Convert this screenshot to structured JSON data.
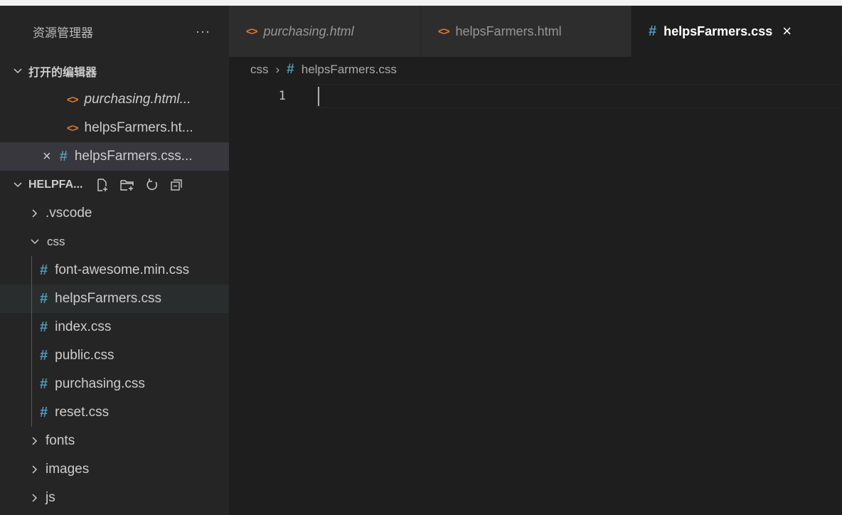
{
  "explorer": {
    "title": "资源管理器",
    "more": "···",
    "open_editors": {
      "label": "打开的编辑器",
      "items": [
        {
          "name": "purchasing.html...",
          "type": "html"
        },
        {
          "name": "helpsFarmers.ht...",
          "type": "html"
        },
        {
          "name": "helpsFarmers.css...",
          "type": "css",
          "close": "×"
        }
      ]
    },
    "workspace": {
      "label": "HELPFA...",
      "tree": [
        {
          "name": ".vscode",
          "kind": "folder",
          "expanded": false
        },
        {
          "name": "css",
          "kind": "folder",
          "expanded": true
        },
        {
          "name": "font-awesome.min.css",
          "kind": "css"
        },
        {
          "name": "helpsFarmers.css",
          "kind": "css"
        },
        {
          "name": "index.css",
          "kind": "css"
        },
        {
          "name": "public.css",
          "kind": "css"
        },
        {
          "name": "purchasing.css",
          "kind": "css"
        },
        {
          "name": "reset.css",
          "kind": "css"
        },
        {
          "name": "fonts",
          "kind": "folder",
          "expanded": false
        },
        {
          "name": "images",
          "kind": "folder",
          "expanded": false
        },
        {
          "name": "js",
          "kind": "folder",
          "expanded": false
        }
      ]
    }
  },
  "tabs": [
    {
      "label": "purchasing.html",
      "type": "html"
    },
    {
      "label": "helpsFarmers.html",
      "type": "html"
    },
    {
      "label": "helpsFarmers.css",
      "type": "css",
      "close": "×"
    }
  ],
  "breadcrumb": {
    "folder": "css",
    "separator": "›",
    "file": "helpsFarmers.css"
  },
  "editor": {
    "line_numbers": [
      "1"
    ]
  },
  "icons": {
    "html": "<>",
    "css": "#"
  },
  "colors": {
    "html_icon": "#e37933",
    "css_icon": "#519aba",
    "editor_bg": "#1e1e1e",
    "sidebar_bg": "#252526"
  }
}
